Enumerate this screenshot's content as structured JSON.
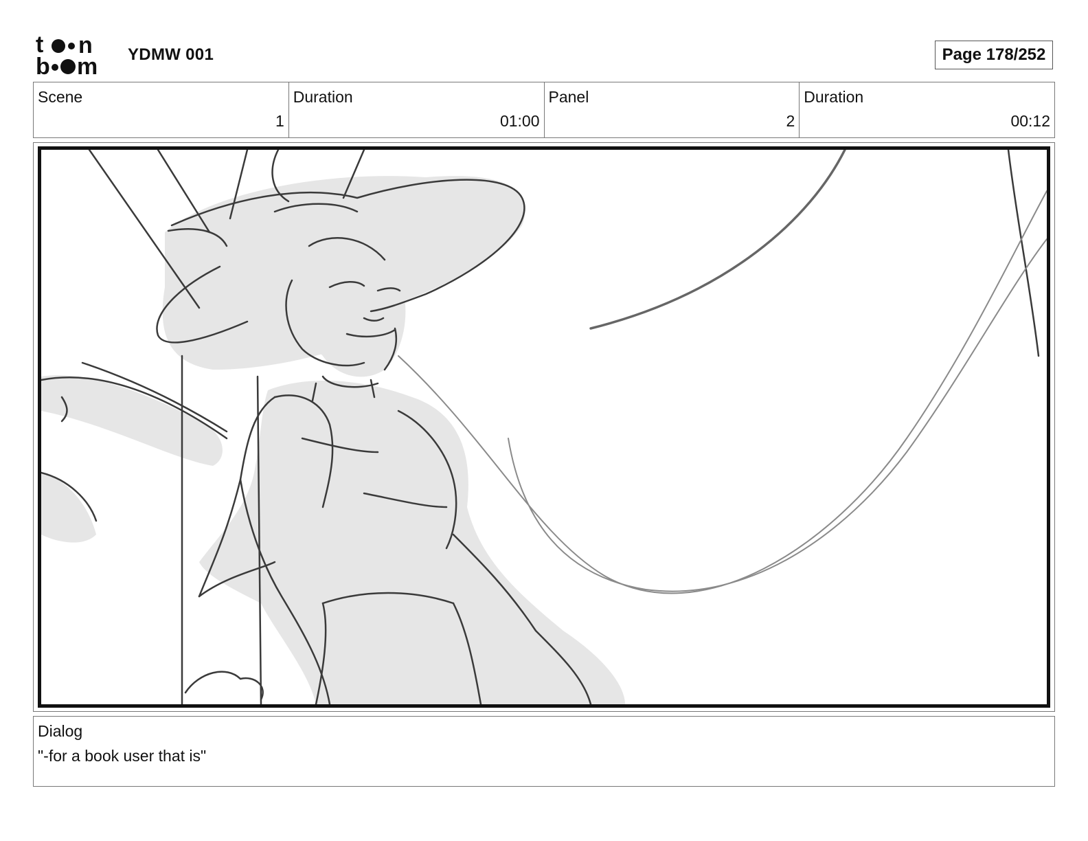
{
  "header": {
    "logo_text": "toonboom",
    "project_title": "YDMW 001",
    "page_label": "Page 178/252"
  },
  "info": {
    "scene_label": "Scene",
    "scene_value": "1",
    "scene_duration_label": "Duration",
    "scene_duration_value": "01:00",
    "panel_label": "Panel",
    "panel_value": "2",
    "panel_duration_label": "Duration",
    "panel_duration_value": "00:12"
  },
  "dialog": {
    "label": "Dialog",
    "text": "\"-for a book user that is\""
  }
}
